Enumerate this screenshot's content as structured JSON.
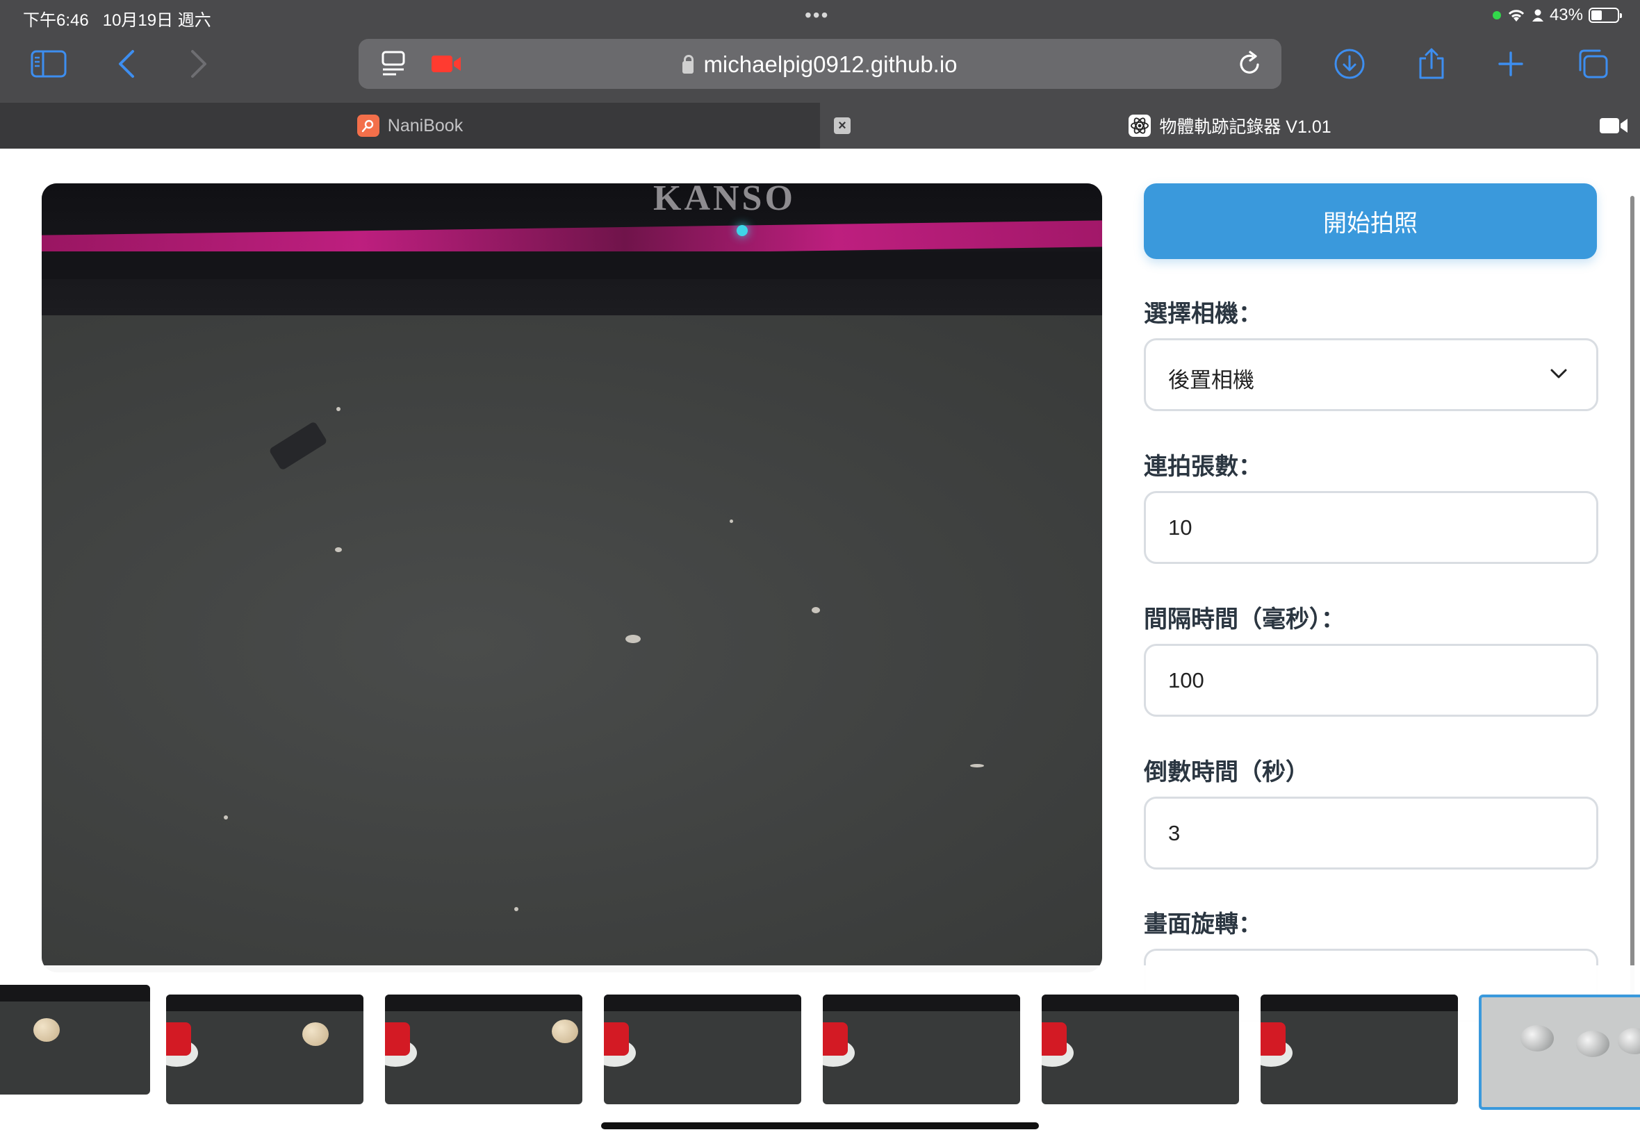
{
  "status_bar": {
    "time": "下午6:46",
    "date": "10月19日 週六",
    "more": "•••",
    "battery": "43%",
    "battery_level": 0.43
  },
  "toolbar": {
    "url": "michaelpig0912.github.io",
    "icons": [
      "sidebar-icon",
      "back-icon",
      "forward-icon",
      "tab-overview-icon",
      "camera-recording-icon",
      "lock-icon",
      "reload-icon",
      "download-icon",
      "share-icon",
      "new-tab-icon",
      "tabs-icon"
    ]
  },
  "tabs": [
    {
      "title": "NaniBook",
      "active": false
    },
    {
      "title": "物體軌跡記錄器 V1.01",
      "active": true
    }
  ],
  "controls": {
    "start_button": "開始拍照",
    "camera_label": "選擇相機：",
    "camera_value": "後置相機",
    "burst_label": "連拍張數：",
    "burst_value": "10",
    "interval_label": "間隔時間（毫秒）：",
    "interval_value": "100",
    "countdown_label": "倒數時間（秒）",
    "countdown_value": "3",
    "rotate_label": "畫面旋轉："
  },
  "preview": {
    "brand_text": "KANSO"
  },
  "colors": {
    "accent": "#3a99dc",
    "chrome": "#4a4a4c",
    "tabbar": "#39393b",
    "label": "#2b3641"
  }
}
